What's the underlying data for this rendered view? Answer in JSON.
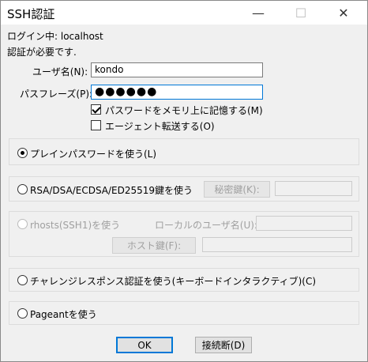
{
  "window": {
    "title": "SSH認証",
    "minimize": "—",
    "maximize": "☐",
    "close": "✕"
  },
  "login": {
    "label": "ログイン中:",
    "host": "localhost"
  },
  "auth_required": "認証が必要です.",
  "username": {
    "label": "ユーザ名(N):",
    "value": "kondo"
  },
  "passphrase": {
    "label": "パスフレーズ(P):",
    "value": "●●●●●●"
  },
  "options": {
    "remember_password": {
      "label": "パスワードをメモリ上に記憶する(M)",
      "checked": true
    },
    "agent_forwarding": {
      "label": "エージェント転送する(O)",
      "checked": false
    }
  },
  "methods": {
    "plain_password": {
      "label": "プレインパスワードを使う(L)",
      "selected": true
    },
    "rsa": {
      "label": "RSA/DSA/ECDSA/ED25519鍵を使う",
      "private_key_button": "秘密鍵(K):",
      "private_key_value": ""
    },
    "rhosts": {
      "label": "rhosts(SSH1)を使う",
      "local_user_label": "ローカルのユーザ名(U):",
      "local_user_value": "",
      "host_key_button": "ホスト鍵(F):",
      "host_key_value": ""
    },
    "challenge": {
      "label": "チャレンジレスポンス認証を使う(キーボードインタラクティブ)(C)"
    },
    "pageant": {
      "label": "Pageantを使う"
    }
  },
  "buttons": {
    "ok": "OK",
    "disconnect": "接続断(D)"
  }
}
